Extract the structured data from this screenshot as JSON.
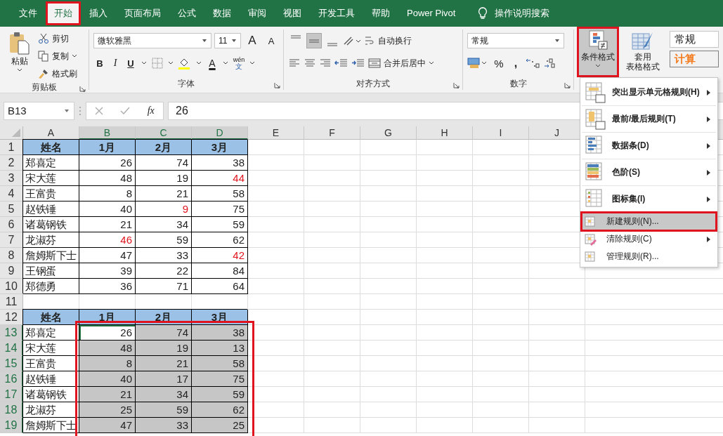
{
  "tabs": [
    {
      "label": "文件",
      "selected": false,
      "annotated": false
    },
    {
      "label": "开始",
      "selected": true,
      "annotated": true
    },
    {
      "label": "插入",
      "selected": false,
      "annotated": false
    },
    {
      "label": "页面布局",
      "selected": false,
      "annotated": false
    },
    {
      "label": "公式",
      "selected": false,
      "annotated": false
    },
    {
      "label": "数据",
      "selected": false,
      "annotated": false
    },
    {
      "label": "审阅",
      "selected": false,
      "annotated": false
    },
    {
      "label": "视图",
      "selected": false,
      "annotated": false
    },
    {
      "label": "开发工具",
      "selected": false,
      "annotated": false
    },
    {
      "label": "帮助",
      "selected": false,
      "annotated": false
    },
    {
      "label": "Power Pivot",
      "selected": false,
      "annotated": false
    }
  ],
  "tell_me": "操作说明搜索",
  "ribbon": {
    "clipboard": {
      "paste": "粘贴",
      "cut": "剪切",
      "copy": "复制",
      "format_painter": "格式刷",
      "label": "剪贴板"
    },
    "font": {
      "font_name": "微软雅黑",
      "font_size": "11",
      "grow_font": "A",
      "shrink_font": "A",
      "bold": "B",
      "italic": "I",
      "underline": "U",
      "font_color": "A",
      "phonetic": "wén",
      "phonetic_sub": "文",
      "label": "字体"
    },
    "alignment": {
      "vertical_align": [
        {
          "selected": false
        },
        {
          "selected": true
        },
        {
          "selected": false
        }
      ],
      "wrap_text": "自动换行",
      "merge_center": "合并后居中",
      "label": "对齐方式"
    },
    "number": {
      "format": "常规",
      "percent": "%",
      "comma": ",",
      "label": "数字"
    },
    "styles": {
      "conditional_format": {
        "label": "条件格式",
        "pressed": true,
        "annotated": true
      },
      "format_table": [
        "套用",
        "表格格式"
      ],
      "cell_styles": [
        {
          "text": "常规",
          "kind": "normal"
        },
        {
          "text": "计算",
          "kind": "calculation"
        }
      ]
    }
  },
  "formula_bar": {
    "name_box": "B13",
    "function_label": "fx",
    "value": "26"
  },
  "sheet": {
    "columns": [
      {
        "label": "A",
        "selected": false
      },
      {
        "label": "B",
        "selected": true
      },
      {
        "label": "C",
        "selected": true
      },
      {
        "label": "D",
        "selected": true
      },
      {
        "label": "E",
        "selected": false
      },
      {
        "label": "F",
        "selected": false
      },
      {
        "label": "G",
        "selected": false
      },
      {
        "label": "H",
        "selected": false
      },
      {
        "label": "I",
        "selected": false
      },
      {
        "label": "J",
        "selected": false
      }
    ],
    "range_annotated": true,
    "rows": [
      {
        "label": "1",
        "selected": false,
        "kind": "header",
        "cells": [
          {
            "text": "姓名",
            "flagged": false,
            "selected": false,
            "active": false
          },
          {
            "text": "1月",
            "flagged": false,
            "selected": false,
            "active": false
          },
          {
            "text": "2月",
            "flagged": false,
            "selected": false,
            "active": false
          },
          {
            "text": "3月",
            "flagged": false,
            "selected": false,
            "active": false
          }
        ]
      },
      {
        "label": "2",
        "selected": false,
        "kind": "data",
        "cells": [
          {
            "text": "郑喜定",
            "flagged": false,
            "selected": false,
            "active": false
          },
          {
            "text": "26",
            "flagged": false,
            "selected": false,
            "active": false
          },
          {
            "text": "74",
            "flagged": false,
            "selected": false,
            "active": false
          },
          {
            "text": "38",
            "flagged": false,
            "selected": false,
            "active": false
          }
        ]
      },
      {
        "label": "3",
        "selected": false,
        "kind": "data",
        "cells": [
          {
            "text": "宋大莲",
            "flagged": false,
            "selected": false,
            "active": false
          },
          {
            "text": "48",
            "flagged": false,
            "selected": false,
            "active": false
          },
          {
            "text": "19",
            "flagged": false,
            "selected": false,
            "active": false
          },
          {
            "text": "44",
            "flagged": true,
            "selected": false,
            "active": false
          }
        ]
      },
      {
        "label": "4",
        "selected": false,
        "kind": "data",
        "cells": [
          {
            "text": "王富贵",
            "flagged": false,
            "selected": false,
            "active": false
          },
          {
            "text": "8",
            "flagged": false,
            "selected": false,
            "active": false
          },
          {
            "text": "21",
            "flagged": false,
            "selected": false,
            "active": false
          },
          {
            "text": "58",
            "flagged": false,
            "selected": false,
            "active": false
          }
        ]
      },
      {
        "label": "5",
        "selected": false,
        "kind": "data",
        "cells": [
          {
            "text": "赵铁锤",
            "flagged": false,
            "selected": false,
            "active": false
          },
          {
            "text": "40",
            "flagged": false,
            "selected": false,
            "active": false
          },
          {
            "text": "9",
            "flagged": true,
            "selected": false,
            "active": false
          },
          {
            "text": "75",
            "flagged": false,
            "selected": false,
            "active": false
          }
        ]
      },
      {
        "label": "6",
        "selected": false,
        "kind": "data",
        "cells": [
          {
            "text": "诸葛钢铁",
            "flagged": false,
            "selected": false,
            "active": false
          },
          {
            "text": "21",
            "flagged": false,
            "selected": false,
            "active": false
          },
          {
            "text": "34",
            "flagged": false,
            "selected": false,
            "active": false
          },
          {
            "text": "59",
            "flagged": false,
            "selected": false,
            "active": false
          }
        ]
      },
      {
        "label": "7",
        "selected": false,
        "kind": "data",
        "cells": [
          {
            "text": "龙淑芬",
            "flagged": false,
            "selected": false,
            "active": false
          },
          {
            "text": "46",
            "flagged": true,
            "selected": false,
            "active": false
          },
          {
            "text": "59",
            "flagged": false,
            "selected": false,
            "active": false
          },
          {
            "text": "62",
            "flagged": false,
            "selected": false,
            "active": false
          }
        ]
      },
      {
        "label": "8",
        "selected": false,
        "kind": "data",
        "cells": [
          {
            "text": "詹姆斯下士",
            "flagged": false,
            "selected": false,
            "active": false
          },
          {
            "text": "47",
            "flagged": false,
            "selected": false,
            "active": false
          },
          {
            "text": "33",
            "flagged": false,
            "selected": false,
            "active": false
          },
          {
            "text": "42",
            "flagged": true,
            "selected": false,
            "active": false
          }
        ]
      },
      {
        "label": "9",
        "selected": false,
        "kind": "data",
        "cells": [
          {
            "text": "王钢蛋",
            "flagged": false,
            "selected": false,
            "active": false
          },
          {
            "text": "39",
            "flagged": false,
            "selected": false,
            "active": false
          },
          {
            "text": "22",
            "flagged": false,
            "selected": false,
            "active": false
          },
          {
            "text": "84",
            "flagged": false,
            "selected": false,
            "active": false
          }
        ]
      },
      {
        "label": "10",
        "selected": false,
        "kind": "data",
        "cells": [
          {
            "text": "郑德勇",
            "flagged": false,
            "selected": false,
            "active": false
          },
          {
            "text": "36",
            "flagged": false,
            "selected": false,
            "active": false
          },
          {
            "text": "71",
            "flagged": false,
            "selected": false,
            "active": false
          },
          {
            "text": "64",
            "flagged": false,
            "selected": false,
            "active": false
          }
        ]
      },
      {
        "label": "11",
        "selected": false,
        "kind": "blank"
      },
      {
        "label": "12",
        "selected": false,
        "kind": "header",
        "cells": [
          {
            "text": "姓名",
            "flagged": false,
            "selected": false,
            "active": false
          },
          {
            "text": "1月",
            "flagged": false,
            "selected": false,
            "active": false
          },
          {
            "text": "2月",
            "flagged": false,
            "selected": false,
            "active": false
          },
          {
            "text": "3月",
            "flagged": false,
            "selected": false,
            "active": false
          }
        ]
      },
      {
        "label": "13",
        "selected": true,
        "kind": "data",
        "cells": [
          {
            "text": "郑喜定",
            "flagged": false,
            "selected": false,
            "active": false
          },
          {
            "text": "26",
            "flagged": false,
            "selected": true,
            "active": true
          },
          {
            "text": "74",
            "flagged": false,
            "selected": true,
            "active": false
          },
          {
            "text": "38",
            "flagged": false,
            "selected": true,
            "active": false
          }
        ]
      },
      {
        "label": "14",
        "selected": true,
        "kind": "data",
        "cells": [
          {
            "text": "宋大莲",
            "flagged": false,
            "selected": false,
            "active": false
          },
          {
            "text": "48",
            "flagged": false,
            "selected": true,
            "active": false
          },
          {
            "text": "19",
            "flagged": false,
            "selected": true,
            "active": false
          },
          {
            "text": "13",
            "flagged": false,
            "selected": true,
            "active": false
          }
        ]
      },
      {
        "label": "15",
        "selected": true,
        "kind": "data",
        "cells": [
          {
            "text": "王富贵",
            "flagged": false,
            "selected": false,
            "active": false
          },
          {
            "text": "8",
            "flagged": false,
            "selected": true,
            "active": false
          },
          {
            "text": "21",
            "flagged": false,
            "selected": true,
            "active": false
          },
          {
            "text": "58",
            "flagged": false,
            "selected": true,
            "active": false
          }
        ]
      },
      {
        "label": "16",
        "selected": true,
        "kind": "data",
        "cells": [
          {
            "text": "赵铁锤",
            "flagged": false,
            "selected": false,
            "active": false
          },
          {
            "text": "40",
            "flagged": false,
            "selected": true,
            "active": false
          },
          {
            "text": "17",
            "flagged": false,
            "selected": true,
            "active": false
          },
          {
            "text": "75",
            "flagged": false,
            "selected": true,
            "active": false
          }
        ]
      },
      {
        "label": "17",
        "selected": true,
        "kind": "data",
        "cells": [
          {
            "text": "诸葛钢铁",
            "flagged": false,
            "selected": false,
            "active": false
          },
          {
            "text": "21",
            "flagged": false,
            "selected": true,
            "active": false
          },
          {
            "text": "34",
            "flagged": false,
            "selected": true,
            "active": false
          },
          {
            "text": "59",
            "flagged": false,
            "selected": true,
            "active": false
          }
        ]
      },
      {
        "label": "18",
        "selected": true,
        "kind": "data",
        "cells": [
          {
            "text": "龙淑芬",
            "flagged": false,
            "selected": false,
            "active": false
          },
          {
            "text": "25",
            "flagged": false,
            "selected": true,
            "active": false
          },
          {
            "text": "59",
            "flagged": false,
            "selected": true,
            "active": false
          },
          {
            "text": "62",
            "flagged": false,
            "selected": true,
            "active": false
          }
        ]
      },
      {
        "label": "19",
        "selected": true,
        "kind": "data",
        "cells": [
          {
            "text": "詹姆斯下士",
            "flagged": false,
            "selected": false,
            "active": false
          },
          {
            "text": "47",
            "flagged": false,
            "selected": true,
            "active": false
          },
          {
            "text": "33",
            "flagged": false,
            "selected": true,
            "active": false
          },
          {
            "text": "25",
            "flagged": false,
            "selected": true,
            "active": false
          }
        ]
      }
    ]
  },
  "conditional_menu": {
    "items": [
      {
        "label": "突出显示单元格规则(H)",
        "kind": "large",
        "has_submenu": true,
        "selected": false,
        "annotated": false
      },
      {
        "label": "最前/最后规则(T)",
        "kind": "large",
        "has_submenu": true,
        "selected": false,
        "annotated": false
      },
      {
        "label": "数据条(D)",
        "kind": "large",
        "has_submenu": true,
        "selected": false,
        "annotated": false
      },
      {
        "label": "色阶(S)",
        "kind": "large",
        "has_submenu": true,
        "selected": false,
        "annotated": false
      },
      {
        "label": "图标集(I)",
        "kind": "large",
        "has_submenu": true,
        "selected": false,
        "annotated": false
      },
      {
        "label": "新建规则(N)...",
        "kind": "small",
        "has_submenu": false,
        "selected": true,
        "annotated": true
      },
      {
        "label": "清除规则(C)",
        "kind": "small",
        "has_submenu": true,
        "selected": false,
        "annotated": false
      },
      {
        "label": "管理规则(R)...",
        "kind": "small",
        "has_submenu": false,
        "selected": false,
        "annotated": false
      }
    ]
  }
}
